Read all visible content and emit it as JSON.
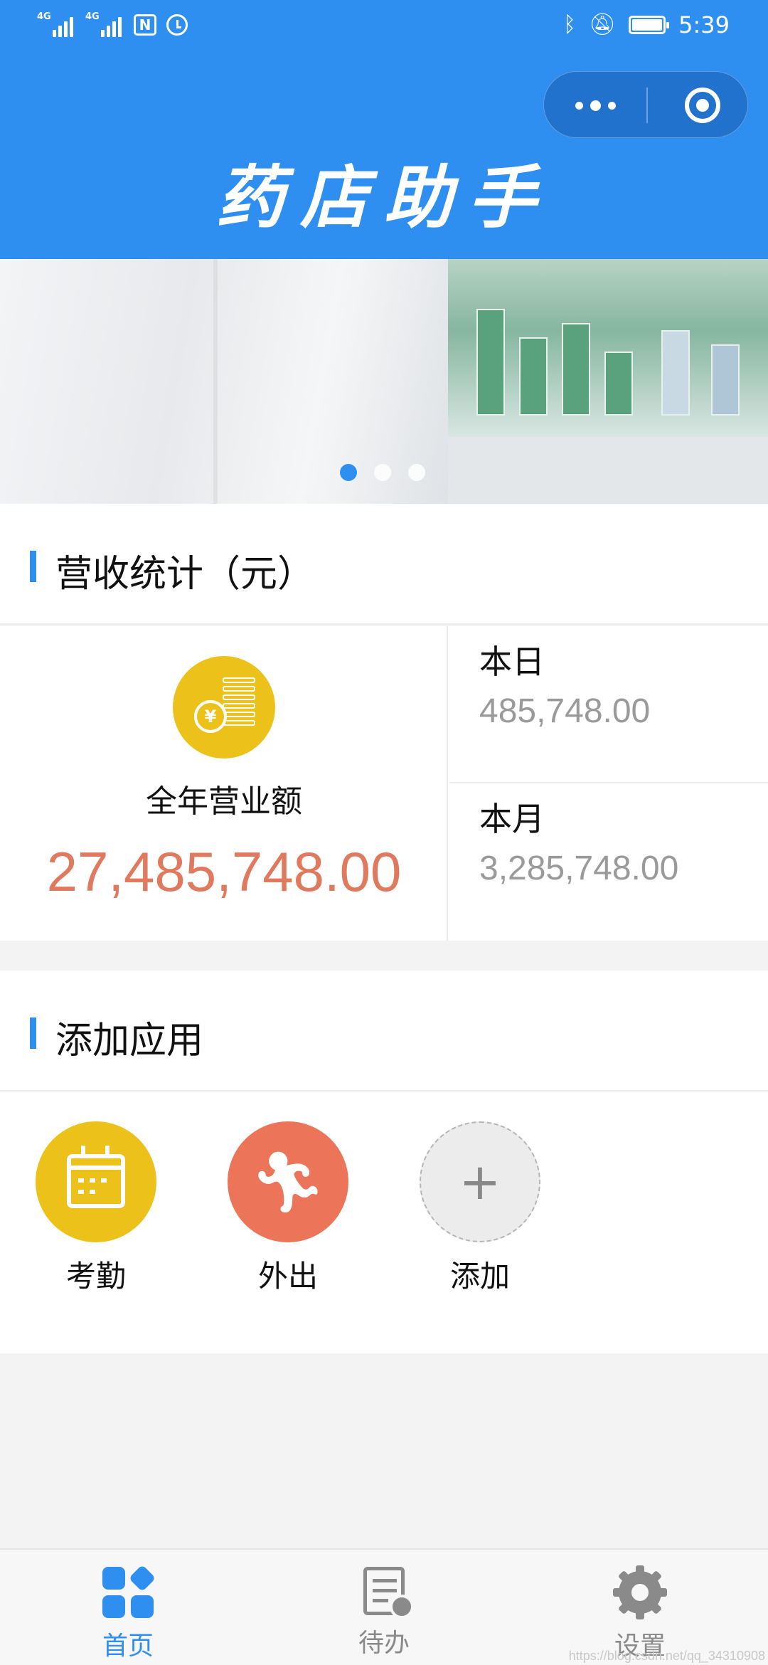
{
  "status_bar": {
    "network_1": "4G",
    "network_2": "4G",
    "nfc": "N",
    "time": "5:39"
  },
  "header": {
    "title": "药店助手"
  },
  "banner": {
    "slide_count": 3,
    "active_slide": 1
  },
  "revenue": {
    "section_title": "营收统计（元）",
    "year_label": "全年营业额",
    "year_value": "27,485,748.00",
    "day_label": "本日",
    "day_value": "485,748.00",
    "month_label": "本月",
    "month_value": "3,285,748.00",
    "year_value_color": "#e07a5f"
  },
  "apps": {
    "section_title": "添加应用",
    "items": [
      {
        "label": "考勤",
        "icon": "calendar-icon",
        "color": "#ecc11a"
      },
      {
        "label": "外出",
        "icon": "walking-person-icon",
        "color": "#ec7458"
      },
      {
        "label": "添加",
        "icon": "plus-icon",
        "color": "#ececec"
      }
    ]
  },
  "tabbar": {
    "items": [
      {
        "label": "首页",
        "icon": "grid-icon",
        "active": true
      },
      {
        "label": "待办",
        "icon": "todo-clock-icon",
        "active": false
      },
      {
        "label": "设置",
        "icon": "gear-icon",
        "active": false
      }
    ]
  },
  "watermark": "https://blog.csdn.net/qq_34310908",
  "colors": {
    "primary": "#2e8ff0",
    "muted_text": "#9a9a9a"
  }
}
